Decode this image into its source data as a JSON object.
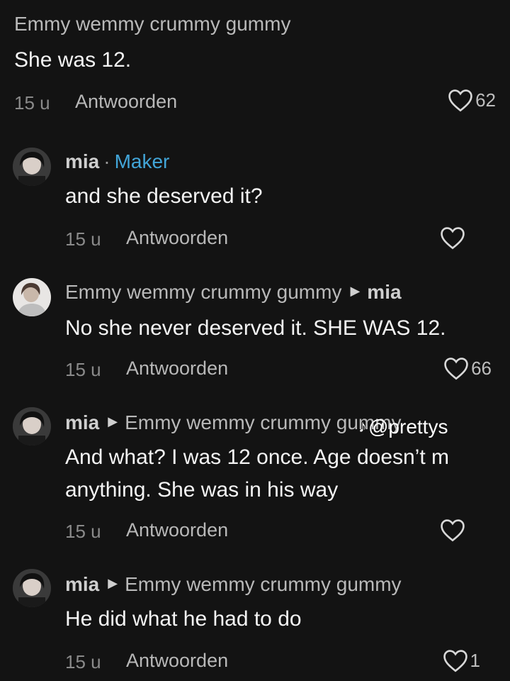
{
  "comments": [
    {
      "username": "Emmy wemmy crummy gummy",
      "text": "She was 12.",
      "time": "15 u",
      "reply_label": "Antwoorden",
      "likes": "62"
    },
    {
      "username": "mia",
      "badge": "Maker",
      "separator": "·",
      "text": "and she deserved it?",
      "time": "15 u",
      "reply_label": "Antwoorden",
      "likes": ""
    },
    {
      "username": "Emmy wemmy crummy gummy",
      "reply_to": "mia",
      "text": "No she never deserved it. SHE WAS 12.",
      "time": "15 u",
      "reply_label": "Antwoorden",
      "likes": "66"
    },
    {
      "username": "mia",
      "reply_to": "Emmy wemmy crummy gummy",
      "text_line1": "And what? I was 12 once. Age doesn’t m",
      "text_line2": "anything. She was in his way",
      "time": "15 u",
      "reply_label": "Antwoorden",
      "likes": ""
    },
    {
      "username": "mia",
      "reply_to": "Emmy wemmy crummy gummy",
      "text": "He did what he had to do",
      "time": "15 u",
      "reply_label": "Antwoorden",
      "likes": "1"
    }
  ],
  "watermark": {
    "icon": "tiktok-logo-icon",
    "handle": "@prettys"
  },
  "colors": {
    "background": "#131313",
    "maker_badge": "#42a5d8",
    "text": "#f4f4f4",
    "muted": "#8a8a8a"
  }
}
